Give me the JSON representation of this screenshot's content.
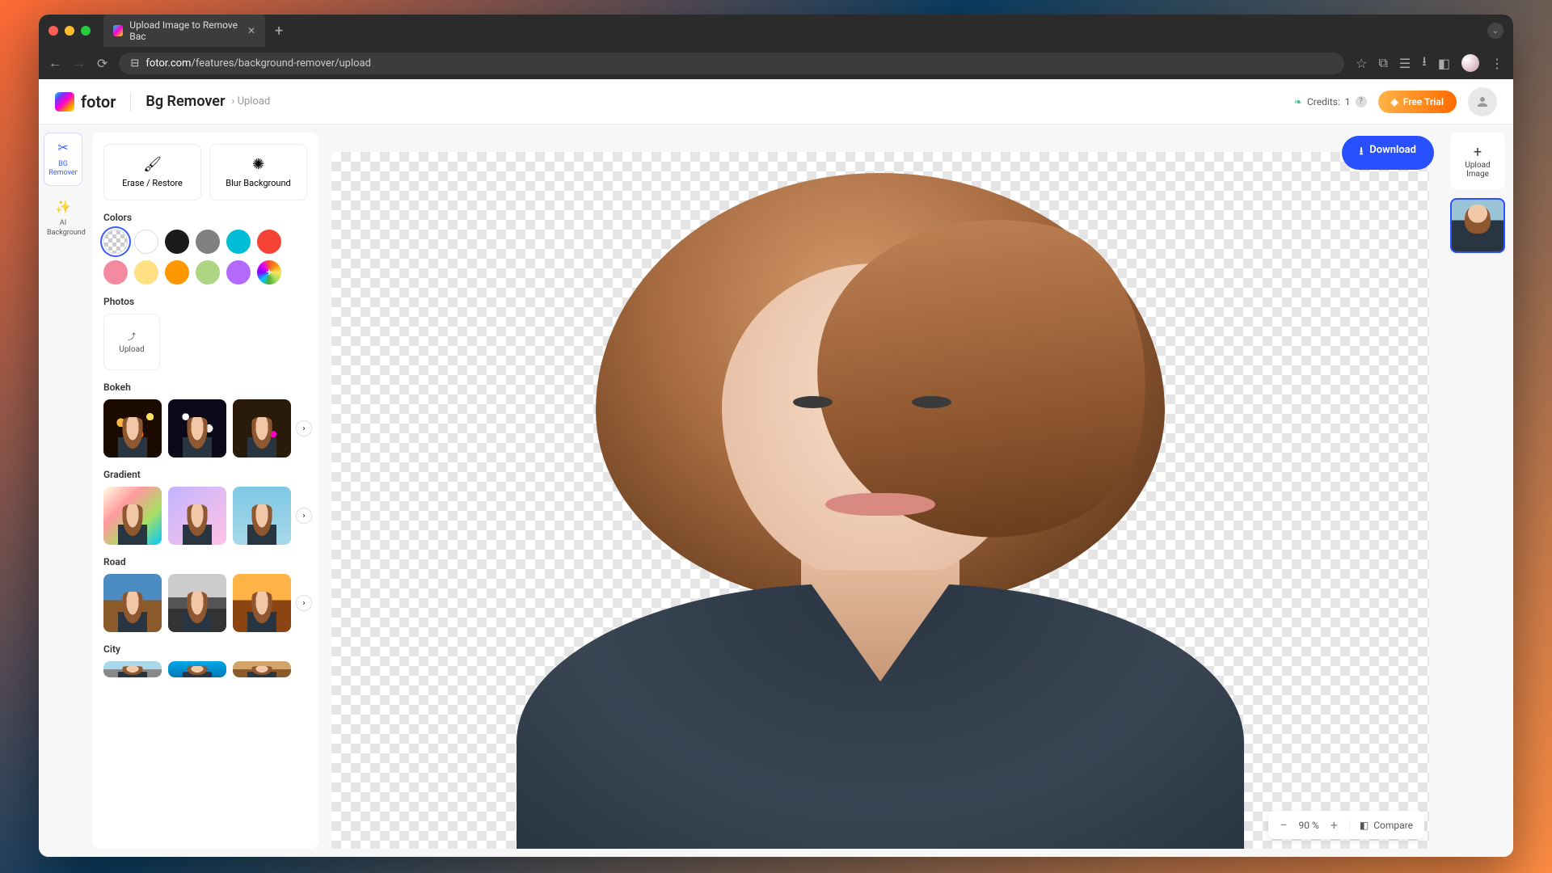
{
  "browser": {
    "tab_title": "Upload Image to Remove Bac",
    "url_display": "fotor.com/features/background-remover/upload",
    "url_domain": "fotor.com"
  },
  "header": {
    "logo_text": "fotor",
    "app_title": "Bg Remover",
    "breadcrumb_sep": "›",
    "breadcrumb_current": "Upload",
    "credits_label": "Credits:",
    "credits_value": "1",
    "free_trial_label": "Free Trial"
  },
  "tool_rail": {
    "items": [
      {
        "icon": "✂",
        "label": "BG Remover",
        "active": true
      },
      {
        "icon": "✨",
        "label": "AI Background",
        "active": false
      }
    ]
  },
  "panel": {
    "erase_label": "Erase / Restore",
    "blur_label": "Blur Background",
    "colors_label": "Colors",
    "colors": [
      {
        "name": "transparent",
        "css": "",
        "selected": true
      },
      {
        "name": "white",
        "css": "#ffffff"
      },
      {
        "name": "black",
        "css": "#1a1a1a"
      },
      {
        "name": "gray",
        "css": "#808080"
      },
      {
        "name": "cyan",
        "css": "#00bcd4"
      },
      {
        "name": "red",
        "css": "#f44336"
      },
      {
        "name": "pink",
        "css": "#f48aa0"
      },
      {
        "name": "yellow",
        "css": "#ffe082"
      },
      {
        "name": "orange",
        "css": "#ff9800"
      },
      {
        "name": "lime",
        "css": "#aed581"
      },
      {
        "name": "purple",
        "css": "#b46aff"
      },
      {
        "name": "rainbow-add",
        "css": ""
      }
    ],
    "photos_label": "Photos",
    "upload_label": "Upload",
    "sections": [
      {
        "label": "Bokeh",
        "thumbs": [
          "bokeh-1",
          "bokeh-2",
          "bokeh-3"
        ]
      },
      {
        "label": "Gradient",
        "thumbs": [
          "grad-1",
          "grad-2",
          "grad-3"
        ]
      },
      {
        "label": "Road",
        "thumbs": [
          "road-1",
          "road-2",
          "road-3"
        ]
      },
      {
        "label": "City",
        "thumbs": [
          "city-1",
          "city-2",
          "city-3"
        ]
      }
    ]
  },
  "canvas": {
    "download_label": "Download",
    "zoom_value": "90 %",
    "compare_label": "Compare"
  },
  "right_rail": {
    "upload_label": "Upload Image"
  }
}
